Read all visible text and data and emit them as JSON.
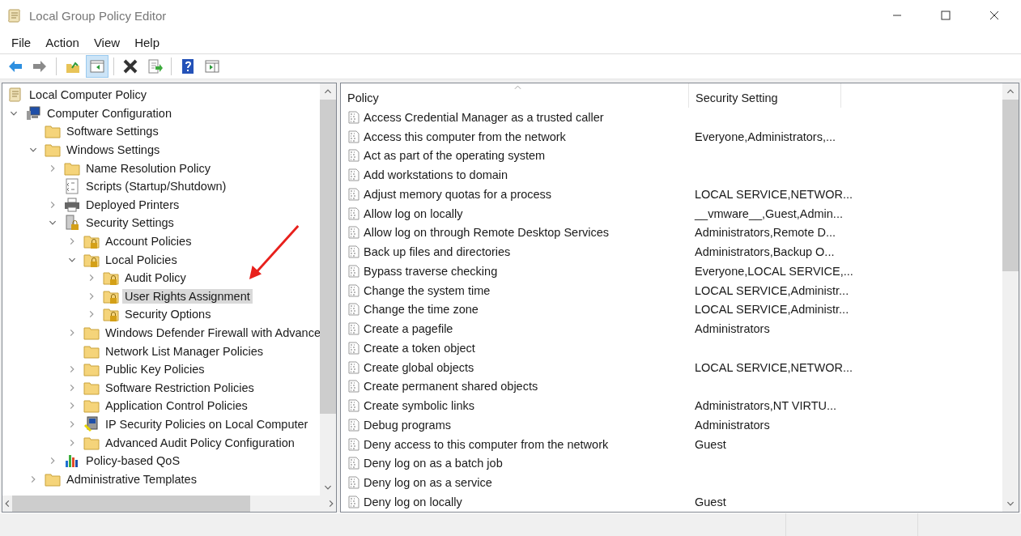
{
  "window": {
    "title": "Local Group Policy Editor"
  },
  "menu": [
    "File",
    "Action",
    "View",
    "Help"
  ],
  "toolbar": [
    {
      "kind": "back",
      "pressed": false
    },
    {
      "kind": "forward",
      "pressed": false
    },
    {
      "kind": "sep"
    },
    {
      "kind": "up",
      "pressed": false
    },
    {
      "kind": "tree",
      "pressed": true
    },
    {
      "kind": "sep"
    },
    {
      "kind": "delete",
      "pressed": false
    },
    {
      "kind": "export",
      "pressed": false
    },
    {
      "kind": "sep"
    },
    {
      "kind": "help",
      "pressed": false
    },
    {
      "kind": "pane",
      "pressed": false
    }
  ],
  "tree": [
    {
      "label": "Local Computer Policy",
      "kind": "scroll",
      "selected": false,
      "children": [
        {
          "label": "Computer Configuration",
          "kind": "computer",
          "expanded": true,
          "selected": false,
          "children": [
            {
              "label": "Software Settings",
              "kind": "folder",
              "selected": false
            },
            {
              "label": "Windows Settings",
              "kind": "folder",
              "expanded": true,
              "selected": false,
              "children": [
                {
                  "label": "Name Resolution Policy",
                  "kind": "folder",
                  "expanded": false,
                  "selected": false
                },
                {
                  "label": "Scripts (Startup/Shutdown)",
                  "kind": "script",
                  "selected": false
                },
                {
                  "label": "Deployed Printers",
                  "kind": "printer",
                  "expanded": false,
                  "selected": false
                },
                {
                  "label": "Security Settings",
                  "kind": "server",
                  "expanded": true,
                  "selected": false,
                  "children": [
                    {
                      "label": "Account Policies",
                      "kind": "lockfolder",
                      "expanded": false,
                      "selected": false
                    },
                    {
                      "label": "Local Policies",
                      "kind": "lockfolder",
                      "expanded": true,
                      "selected": false,
                      "children": [
                        {
                          "label": "Audit Policy",
                          "kind": "lockfolder",
                          "expanded": false,
                          "selected": false
                        },
                        {
                          "label": "User Rights Assignment",
                          "kind": "lockfolder",
                          "expanded": false,
                          "selected": true
                        },
                        {
                          "label": "Security Options",
                          "kind": "lockfolder",
                          "expanded": false,
                          "selected": false
                        }
                      ]
                    },
                    {
                      "label": "Windows Defender Firewall with Advance",
                      "kind": "folder",
                      "expanded": false,
                      "selected": false
                    },
                    {
                      "label": "Network List Manager Policies",
                      "kind": "folder",
                      "selected": false
                    },
                    {
                      "label": "Public Key Policies",
                      "kind": "folder",
                      "expanded": false,
                      "selected": false
                    },
                    {
                      "label": "Software Restriction Policies",
                      "kind": "folder",
                      "expanded": false,
                      "selected": false
                    },
                    {
                      "label": "Application Control Policies",
                      "kind": "folder",
                      "expanded": false,
                      "selected": false
                    },
                    {
                      "label": "IP Security Policies on Local Computer",
                      "kind": "ipsec",
                      "expanded": false,
                      "selected": false
                    },
                    {
                      "label": "Advanced Audit Policy Configuration",
                      "kind": "folder",
                      "expanded": false,
                      "selected": false
                    }
                  ]
                },
                {
                  "label": "Policy-based QoS",
                  "kind": "chart",
                  "expanded": false,
                  "selected": false
                }
              ]
            },
            {
              "label": "Administrative Templates",
              "kind": "folder",
              "expanded": false,
              "selected": false
            }
          ]
        }
      ]
    }
  ],
  "table": {
    "columns": [
      "Policy",
      "Security Setting"
    ],
    "rows": [
      {
        "policy": "Access Credential Manager as a trusted caller",
        "setting": ""
      },
      {
        "policy": "Access this computer from the network",
        "setting": "Everyone,Administrators,..."
      },
      {
        "policy": "Act as part of the operating system",
        "setting": ""
      },
      {
        "policy": "Add workstations to domain",
        "setting": ""
      },
      {
        "policy": "Adjust memory quotas for a process",
        "setting": "LOCAL SERVICE,NETWOR..."
      },
      {
        "policy": "Allow log on locally",
        "setting": "__vmware__,Guest,Admin..."
      },
      {
        "policy": "Allow log on through Remote Desktop Services",
        "setting": "Administrators,Remote D..."
      },
      {
        "policy": "Back up files and directories",
        "setting": "Administrators,Backup O..."
      },
      {
        "policy": "Bypass traverse checking",
        "setting": "Everyone,LOCAL SERVICE,..."
      },
      {
        "policy": "Change the system time",
        "setting": "LOCAL SERVICE,Administr..."
      },
      {
        "policy": "Change the time zone",
        "setting": "LOCAL SERVICE,Administr..."
      },
      {
        "policy": "Create a pagefile",
        "setting": "Administrators"
      },
      {
        "policy": "Create a token object",
        "setting": ""
      },
      {
        "policy": "Create global objects",
        "setting": "LOCAL SERVICE,NETWOR..."
      },
      {
        "policy": "Create permanent shared objects",
        "setting": ""
      },
      {
        "policy": "Create symbolic links",
        "setting": "Administrators,NT VIRTU..."
      },
      {
        "policy": "Debug programs",
        "setting": "Administrators"
      },
      {
        "policy": "Deny access to this computer from the network",
        "setting": "Guest"
      },
      {
        "policy": "Deny log on as a batch job",
        "setting": ""
      },
      {
        "policy": "Deny log on as a service",
        "setting": ""
      },
      {
        "policy": "Deny log on locally",
        "setting": "Guest"
      }
    ]
  }
}
